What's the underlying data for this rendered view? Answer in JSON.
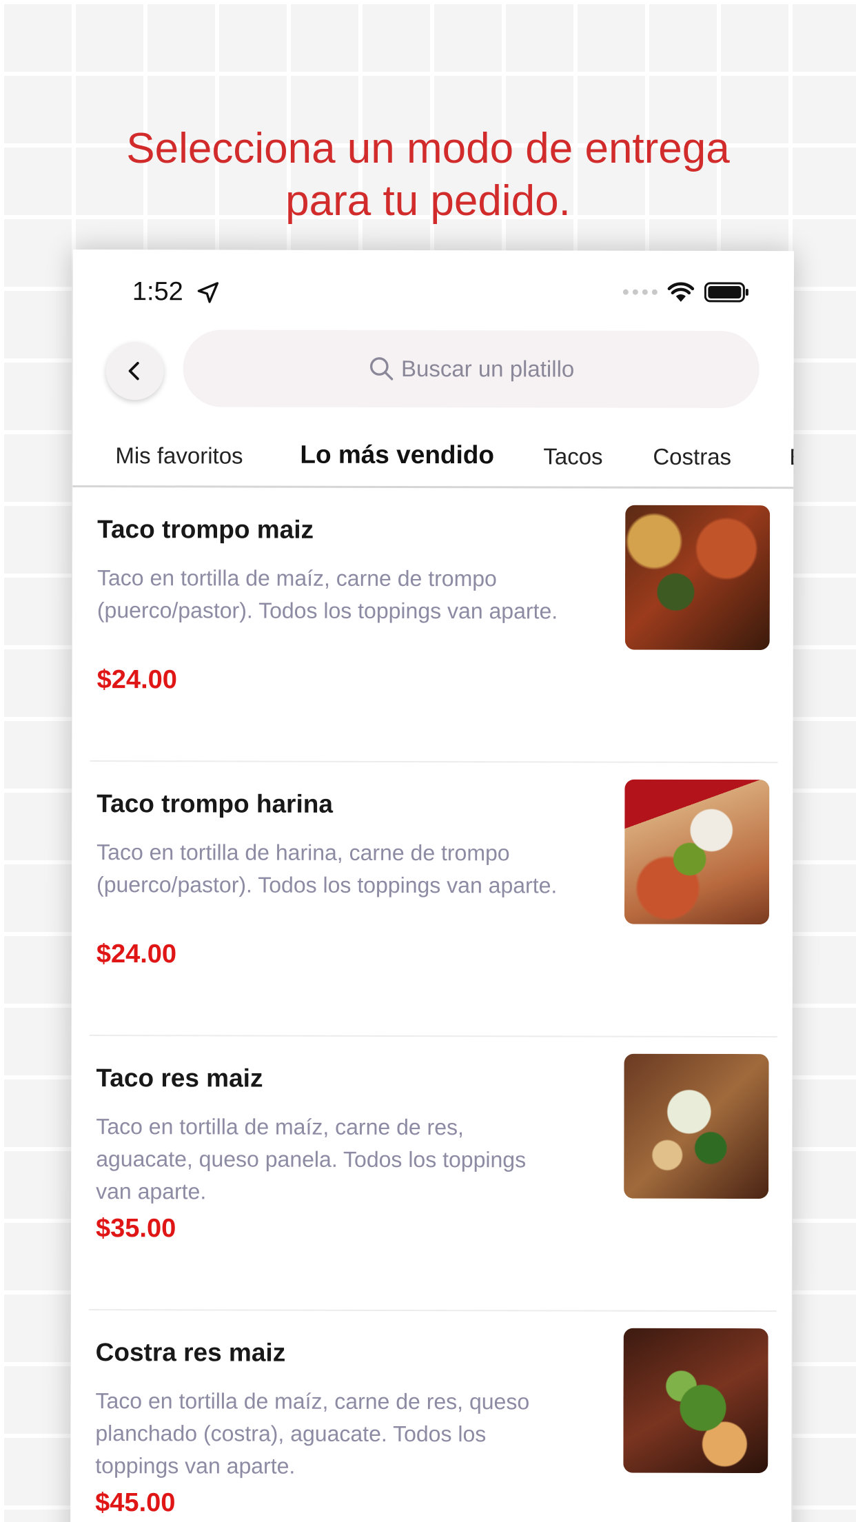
{
  "headline": {
    "line1": "Selecciona un modo de entrega",
    "line2": "para tu pedido."
  },
  "status_bar": {
    "time": "1:52"
  },
  "search": {
    "placeholder": "Buscar un platillo"
  },
  "tabs": [
    {
      "label": "Mis favoritos",
      "active": false
    },
    {
      "label": "Lo más vendido",
      "active": true
    },
    {
      "label": "Tacos",
      "active": false
    },
    {
      "label": "Costras",
      "active": false
    },
    {
      "label": "B",
      "active": false
    }
  ],
  "menu_items": [
    {
      "name": "Taco trompo maiz",
      "description": "Taco en tortilla de maíz, carne de trompo (puerco/pastor). Todos los toppings van aparte.",
      "price": "$24.00"
    },
    {
      "name": "Taco trompo harina",
      "description": "Taco en tortilla de harina, carne de trompo (puerco/pastor). Todos los toppings van aparte.",
      "price": "$24.00"
    },
    {
      "name": "Taco res maiz",
      "description": "Taco en tortilla de maíz, carne de res, aguacate, queso panela. Todos los toppings van aparte.",
      "price": "$35.00"
    },
    {
      "name": "Costra res maiz",
      "description": "Taco en tortilla de maíz, carne de res, queso planchado (costra), aguacate. Todos los toppings van aparte.",
      "price": "$45.00"
    }
  ],
  "colors": {
    "headline": "#d22b2b",
    "price": "#e01616",
    "description": "#8d8ba3"
  }
}
